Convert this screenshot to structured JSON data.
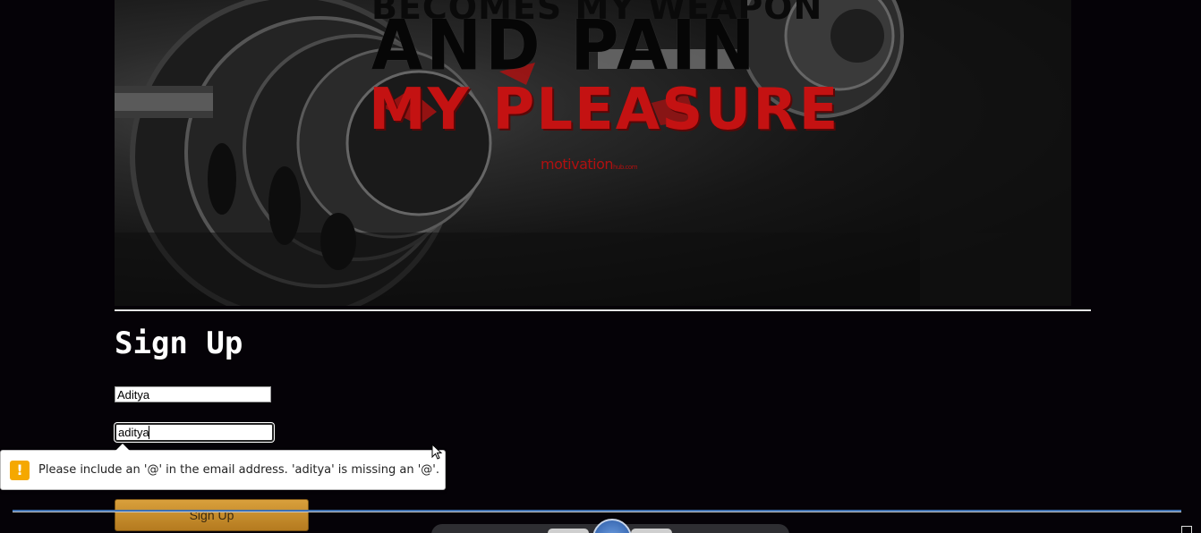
{
  "hero": {
    "line1": "BECOMES MY WEAPON",
    "line2": "AND PAIN",
    "line3": "MY PLEASURE",
    "brand": "motivation",
    "brand_suffix": "hub.com"
  },
  "form": {
    "title": "Sign Up",
    "name_value": "Aditya",
    "email_value": "aditya",
    "submit_label": "Sign Up"
  },
  "validation": {
    "icon_glyph": "!",
    "message": "Please include an '@' in the email address. 'aditya' is missing an '@'.",
    "icon_color": "#f5a800"
  },
  "colors": {
    "background": "#050207",
    "button": "#c98f2e",
    "accent_red": "#c41212"
  }
}
